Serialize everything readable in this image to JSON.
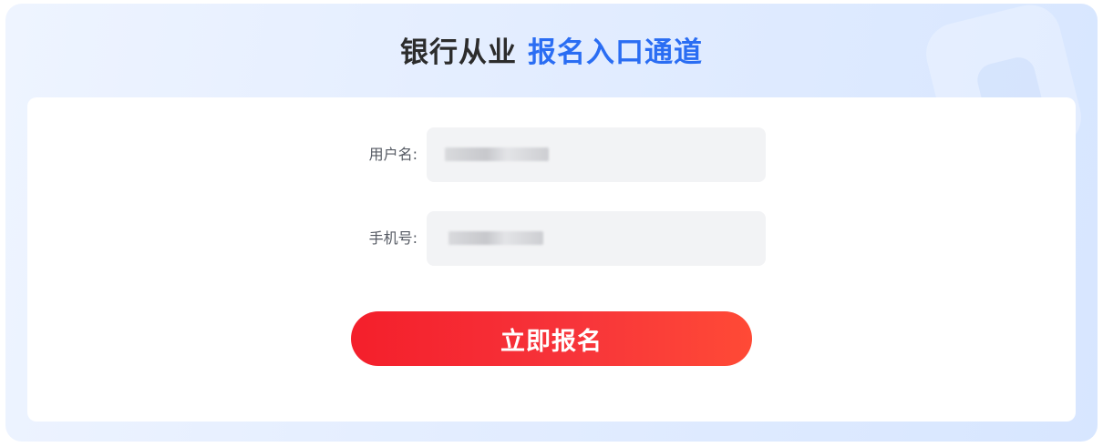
{
  "header": {
    "title_part1": "银行从业",
    "title_part2": "报名入口通道"
  },
  "form": {
    "username": {
      "label": "用户名:",
      "value": ""
    },
    "phone": {
      "label": "手机号:",
      "value": ""
    },
    "submit_label": "立即报名"
  },
  "colors": {
    "accent_blue": "#2a6df3",
    "button_red": "#f41f2b",
    "field_bg": "#f2f3f5"
  }
}
